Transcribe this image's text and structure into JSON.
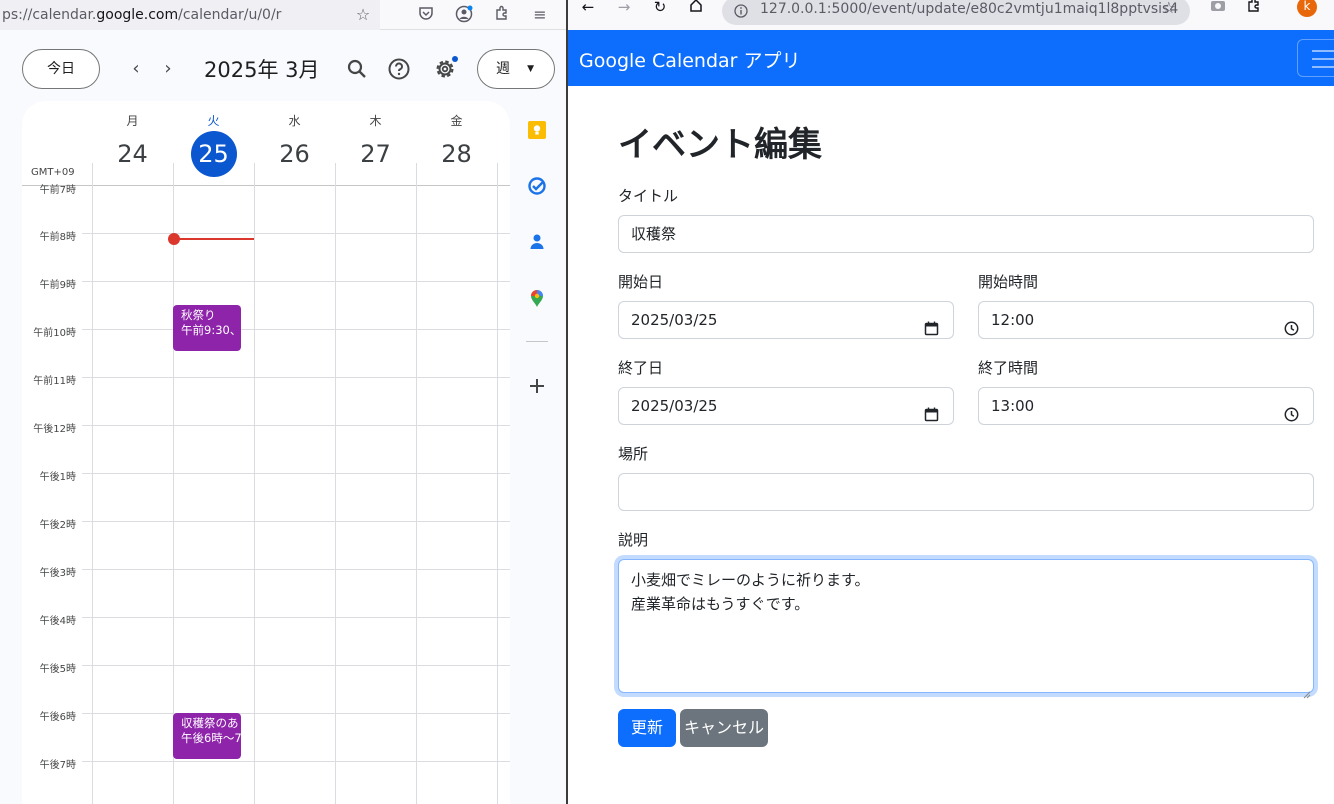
{
  "left_browser": {
    "url_prefix": "ps://calendar.",
    "url_domain": "google.com",
    "url_suffix": "/calendar/u/0/r"
  },
  "calendar": {
    "today_label": "今日",
    "title": "2025年 3月",
    "view_label": "週",
    "timezone": "GMT+09",
    "days": [
      {
        "weekday": "月",
        "date": "24"
      },
      {
        "weekday": "火",
        "date": "25"
      },
      {
        "weekday": "水",
        "date": "26"
      },
      {
        "weekday": "木",
        "date": "27"
      },
      {
        "weekday": "金",
        "date": "28"
      }
    ],
    "hours": [
      "午前7時",
      "午前8時",
      "午前9時",
      "午前10時",
      "午前11時",
      "午後12時",
      "午後1時",
      "午後2時",
      "午後3時",
      "午後4時",
      "午後5時",
      "午後6時",
      "午後7時"
    ],
    "events": [
      {
        "title": "秋祭り",
        "time": "午前9:30、"
      },
      {
        "title": "収穫祭のあ",
        "time": "午後6時～7"
      }
    ]
  },
  "right_browser": {
    "url": "127.0.0.1:5000/event/update/e80c2vmtju1maiq1l8pptvsis4",
    "avatar_letter": "k"
  },
  "app": {
    "brand": "Google Calendar アプリ",
    "page_title": "イベント編集",
    "form": {
      "title_label": "タイトル",
      "title_value": "収穫祭",
      "start_date_label": "開始日",
      "start_date_value": "2025/03/25",
      "start_time_label": "開始時間",
      "start_time_value": "12:00",
      "end_date_label": "終了日",
      "end_date_value": "2025/03/25",
      "end_time_label": "終了時間",
      "end_time_value": "13:00",
      "location_label": "場所",
      "location_value": "",
      "description_label": "説明",
      "description_lines": [
        "小麦畑でミレーのように祈ります。",
        "産業革命はもうすぐです。"
      ],
      "update_button": "更新",
      "cancel_button": "キャンセル"
    }
  },
  "colors": {
    "calendar_today": "#0b57d0",
    "event": "#8e24aa",
    "now_line": "#db372d",
    "navbar": "#0d6efd",
    "secondary": "#6c757d"
  }
}
